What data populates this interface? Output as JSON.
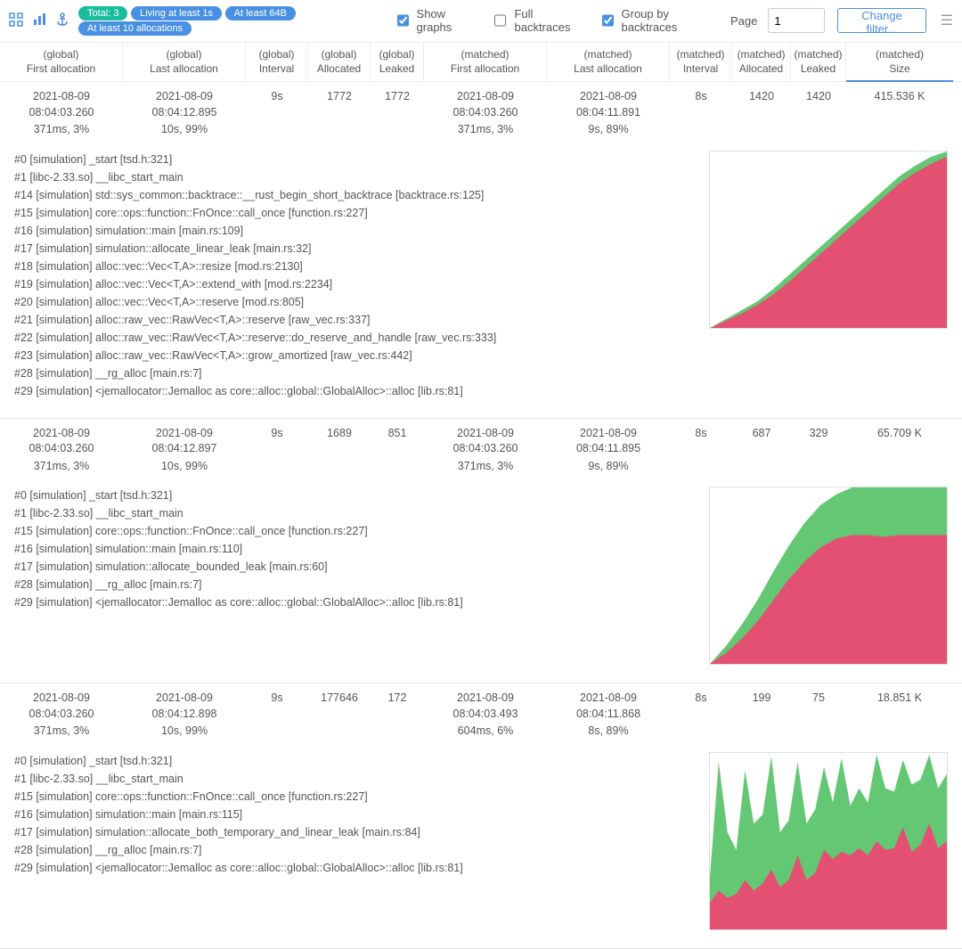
{
  "toolbar": {
    "pills": [
      {
        "text": "Total: 3",
        "color": "teal"
      },
      {
        "text": "Living at least 1s",
        "color": "blue"
      },
      {
        "text": "At least 64B",
        "color": "blue"
      },
      {
        "text": "At least 10 allocations",
        "color": "blue"
      }
    ],
    "show_graphs": {
      "label": "Show graphs",
      "checked": true
    },
    "full_backtraces": {
      "label": "Full backtraces",
      "checked": false
    },
    "group_by_backtraces": {
      "label": "Group by backtraces",
      "checked": true
    },
    "page_label": "Page",
    "page_value": "1",
    "change_filter": "Change filter..."
  },
  "columns": [
    {
      "top": "(global)",
      "bot": "First allocation"
    },
    {
      "top": "(global)",
      "bot": "Last allocation"
    },
    {
      "top": "(global)",
      "bot": "Interval"
    },
    {
      "top": "(global)",
      "bot": "Allocated"
    },
    {
      "top": "(global)",
      "bot": "Leaked"
    },
    {
      "top": "(matched)",
      "bot": "First allocation"
    },
    {
      "top": "(matched)",
      "bot": "Last allocation"
    },
    {
      "top": "(matched)",
      "bot": "Interval"
    },
    {
      "top": "(matched)",
      "bot": "Allocated"
    },
    {
      "top": "(matched)",
      "bot": "Leaked"
    },
    {
      "top": "(matched)",
      "bot": "Size"
    }
  ],
  "active_col": 10,
  "groups": [
    {
      "cells": [
        {
          "l1": "2021-08-09 08:04:03.260",
          "l2": "371ms, 3%"
        },
        {
          "l1": "2021-08-09 08:04:12.895",
          "l2": "10s, 99%"
        },
        {
          "l1": "9s",
          "l2": ""
        },
        {
          "l1": "1772",
          "l2": ""
        },
        {
          "l1": "1772",
          "l2": ""
        },
        {
          "l1": "2021-08-09 08:04:03.260",
          "l2": "371ms, 3%"
        },
        {
          "l1": "2021-08-09 08:04:11.891",
          "l2": "9s, 89%"
        },
        {
          "l1": "8s",
          "l2": ""
        },
        {
          "l1": "1420",
          "l2": ""
        },
        {
          "l1": "1420",
          "l2": ""
        },
        {
          "l1": "415.536 K",
          "l2": ""
        }
      ],
      "backtrace": [
        "#0 [simulation] _start [tsd.h:321]",
        "#1 [libc-2.33.so] __libc_start_main",
        "#14 [simulation] std::sys_common::backtrace::__rust_begin_short_backtrace [backtrace.rs:125]",
        "#15 [simulation] core::ops::function::FnOnce::call_once [function.rs:227]",
        "#16 [simulation] simulation::main [main.rs:109]",
        "#17 [simulation] simulation::allocate_linear_leak [main.rs:32]",
        "#18 [simulation] alloc::vec::Vec<T,A>::resize [mod.rs:2130]",
        "#19 [simulation] alloc::vec::Vec<T,A>::extend_with [mod.rs:2234]",
        "#20 [simulation] alloc::vec::Vec<T,A>::reserve [mod.rs:805]",
        "#21 [simulation] alloc::raw_vec::RawVec<T,A>::reserve [raw_vec.rs:337]",
        "#22 [simulation] alloc::raw_vec::RawVec<T,A>::reserve::do_reserve_and_handle [raw_vec.rs:333]",
        "#23 [simulation] alloc::raw_vec::RawVec<T,A>::grow_amortized [raw_vec.rs:442]",
        "#28 [simulation] __rg_alloc [main.rs:7]",
        "#29 [simulation] <jemallocator::Jemalloc as core::alloc::global::GlobalAlloc>::alloc [lib.rs:81]"
      ],
      "chart_data": {
        "type": "area",
        "series": [
          {
            "name": "allocated",
            "color": "#5cc46b",
            "values": [
              0,
              0.05,
              0.1,
              0.15,
              0.22,
              0.3,
              0.38,
              0.46,
              0.54,
              0.62,
              0.7,
              0.78,
              0.86,
              0.92,
              0.97,
              1.0
            ]
          },
          {
            "name": "leaked",
            "color": "#ea4a71",
            "values": [
              0,
              0.04,
              0.08,
              0.13,
              0.19,
              0.26,
              0.34,
              0.42,
              0.5,
              0.58,
              0.66,
              0.74,
              0.82,
              0.88,
              0.93,
              0.97
            ]
          }
        ],
        "x": [
          0,
          1,
          2,
          3,
          4,
          5,
          6,
          7,
          8,
          9,
          10,
          11,
          12,
          13,
          14,
          15
        ],
        "ylim": [
          0,
          1
        ]
      }
    },
    {
      "cells": [
        {
          "l1": "2021-08-09 08:04:03.260",
          "l2": "371ms, 3%"
        },
        {
          "l1": "2021-08-09 08:04:12.897",
          "l2": "10s, 99%"
        },
        {
          "l1": "9s",
          "l2": ""
        },
        {
          "l1": "1689",
          "l2": ""
        },
        {
          "l1": "851",
          "l2": ""
        },
        {
          "l1": "2021-08-09 08:04:03.260",
          "l2": "371ms, 3%"
        },
        {
          "l1": "2021-08-09 08:04:11.895",
          "l2": "9s, 89%"
        },
        {
          "l1": "8s",
          "l2": ""
        },
        {
          "l1": "687",
          "l2": ""
        },
        {
          "l1": "329",
          "l2": ""
        },
        {
          "l1": "65.709 K",
          "l2": ""
        }
      ],
      "backtrace": [
        "#0 [simulation] _start [tsd.h:321]",
        "#1 [libc-2.33.so] __libc_start_main",
        "#15 [simulation] core::ops::function::FnOnce::call_once [function.rs:227]",
        "#16 [simulation] simulation::main [main.rs:110]",
        "#17 [simulation] simulation::allocate_bounded_leak [main.rs:60]",
        "#28 [simulation] __rg_alloc [main.rs:7]",
        "#29 [simulation] <jemallocator::Jemalloc as core::alloc::global::GlobalAlloc>::alloc [lib.rs:81]"
      ],
      "chart_data": {
        "type": "area",
        "series": [
          {
            "name": "allocated",
            "color": "#5cc46b",
            "values": [
              0,
              0.1,
              0.22,
              0.36,
              0.52,
              0.67,
              0.8,
              0.9,
              0.96,
              1.0,
              1.0,
              1.0,
              1.0,
              1.0,
              1.0,
              1.0
            ]
          },
          {
            "name": "leaked",
            "color": "#ea4a71",
            "values": [
              0,
              0.06,
              0.14,
              0.24,
              0.36,
              0.48,
              0.58,
              0.66,
              0.71,
              0.73,
              0.73,
              0.72,
              0.73,
              0.73,
              0.73,
              0.73
            ]
          }
        ],
        "x": [
          0,
          1,
          2,
          3,
          4,
          5,
          6,
          7,
          8,
          9,
          10,
          11,
          12,
          13,
          14,
          15
        ],
        "ylim": [
          0,
          1
        ]
      }
    },
    {
      "cells": [
        {
          "l1": "2021-08-09 08:04:03.260",
          "l2": "371ms, 3%"
        },
        {
          "l1": "2021-08-09 08:04:12.898",
          "l2": "10s, 99%"
        },
        {
          "l1": "9s",
          "l2": ""
        },
        {
          "l1": "177646",
          "l2": ""
        },
        {
          "l1": "172",
          "l2": ""
        },
        {
          "l1": "2021-08-09 08:04:03.493",
          "l2": "604ms, 6%"
        },
        {
          "l1": "2021-08-09 08:04:11.868",
          "l2": "8s, 89%"
        },
        {
          "l1": "8s",
          "l2": ""
        },
        {
          "l1": "199",
          "l2": ""
        },
        {
          "l1": "75",
          "l2": ""
        },
        {
          "l1": "18.851 K",
          "l2": ""
        }
      ],
      "backtrace": [
        "#0 [simulation] _start [tsd.h:321]",
        "#1 [libc-2.33.so] __libc_start_main",
        "#15 [simulation] core::ops::function::FnOnce::call_once [function.rs:227]",
        "#16 [simulation] simulation::main [main.rs:115]",
        "#17 [simulation] simulation::allocate_both_temporary_and_linear_leak [main.rs:84]",
        "#28 [simulation] __rg_alloc [main.rs:7]",
        "#29 [simulation] <jemallocator::Jemalloc as core::alloc::global::GlobalAlloc>::alloc [lib.rs:81]"
      ],
      "chart_data": {
        "type": "area",
        "series": [
          {
            "name": "allocated",
            "color": "#5cc46b",
            "values": [
              0.3,
              0.95,
              0.55,
              0.45,
              0.9,
              0.6,
              0.65,
              0.98,
              0.55,
              0.62,
              0.95,
              0.6,
              0.68,
              0.92,
              0.72,
              0.97,
              0.7,
              0.8,
              0.72,
              0.99,
              0.8,
              0.78,
              0.96,
              0.82,
              0.85,
              0.99,
              0.8,
              0.88
            ]
          },
          {
            "name": "leaked",
            "color": "#ea4a71",
            "values": [
              0.15,
              0.22,
              0.18,
              0.2,
              0.28,
              0.22,
              0.26,
              0.34,
              0.24,
              0.28,
              0.42,
              0.28,
              0.32,
              0.45,
              0.4,
              0.44,
              0.42,
              0.46,
              0.42,
              0.5,
              0.45,
              0.46,
              0.58,
              0.44,
              0.48,
              0.6,
              0.46,
              0.5
            ]
          }
        ],
        "x": [
          0,
          1,
          2,
          3,
          4,
          5,
          6,
          7,
          8,
          9,
          10,
          11,
          12,
          13,
          14,
          15,
          16,
          17,
          18,
          19,
          20,
          21,
          22,
          23,
          24,
          25,
          26,
          27
        ],
        "ylim": [
          0,
          1
        ]
      }
    }
  ]
}
